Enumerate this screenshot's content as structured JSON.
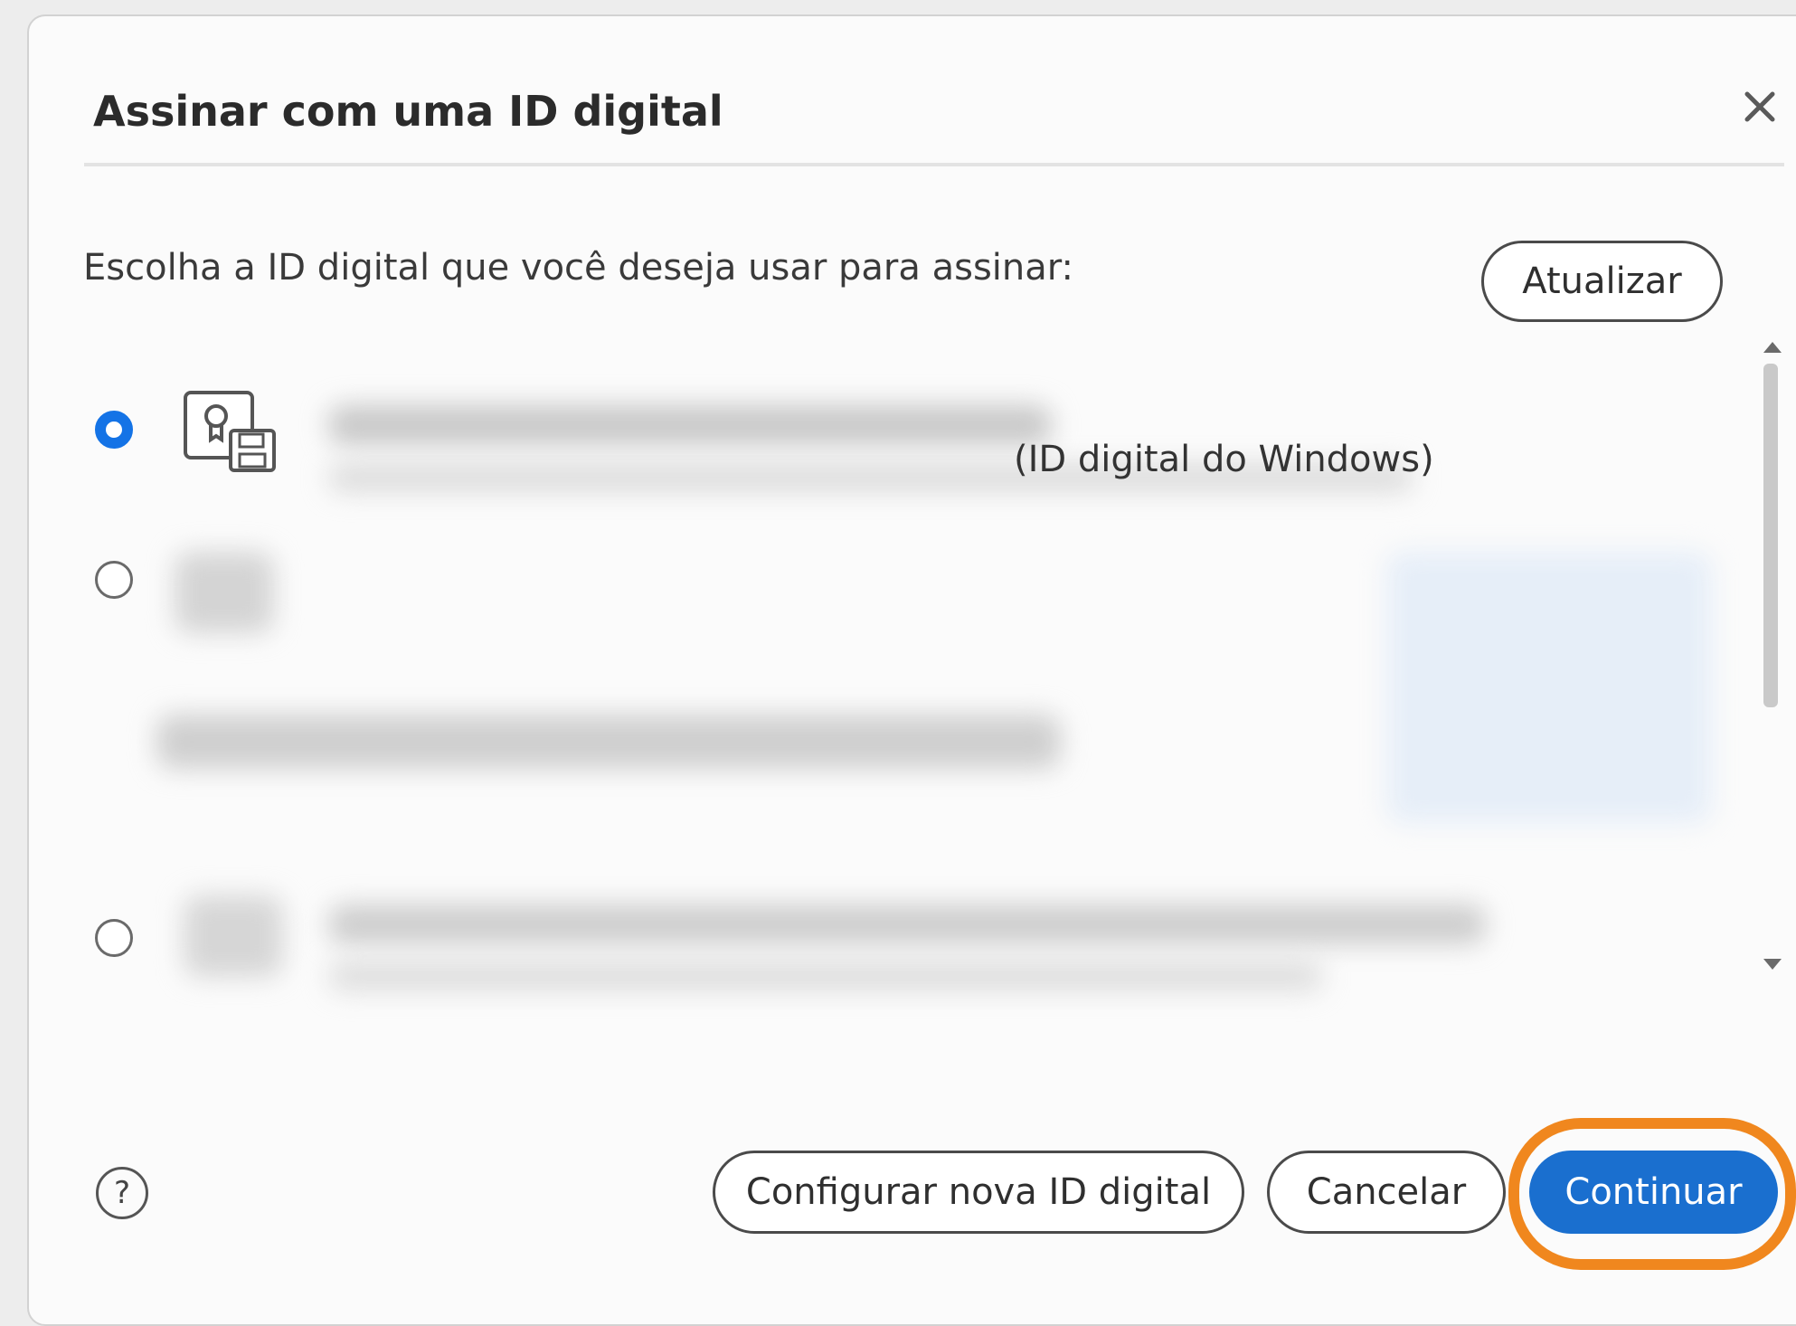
{
  "dialog": {
    "title": "Assinar com uma ID digital",
    "close_icon": "close-icon",
    "prompt": "Escolha a ID digital que você deseja usar para assinar:",
    "refresh_label": "Atualizar"
  },
  "ids": [
    {
      "selected": true,
      "type_label": "(ID digital do Windows)",
      "icon": "certificate-save-icon"
    },
    {
      "selected": false
    },
    {
      "selected": false
    }
  ],
  "footer": {
    "help_icon": "help-icon",
    "help_symbol": "?",
    "configure_label": "Configurar nova ID digital",
    "cancel_label": "Cancelar",
    "continue_label": "Continuar"
  },
  "colors": {
    "accent": "#1473e6",
    "primary_button": "#1a6fcf",
    "highlight": "#f0871e"
  }
}
